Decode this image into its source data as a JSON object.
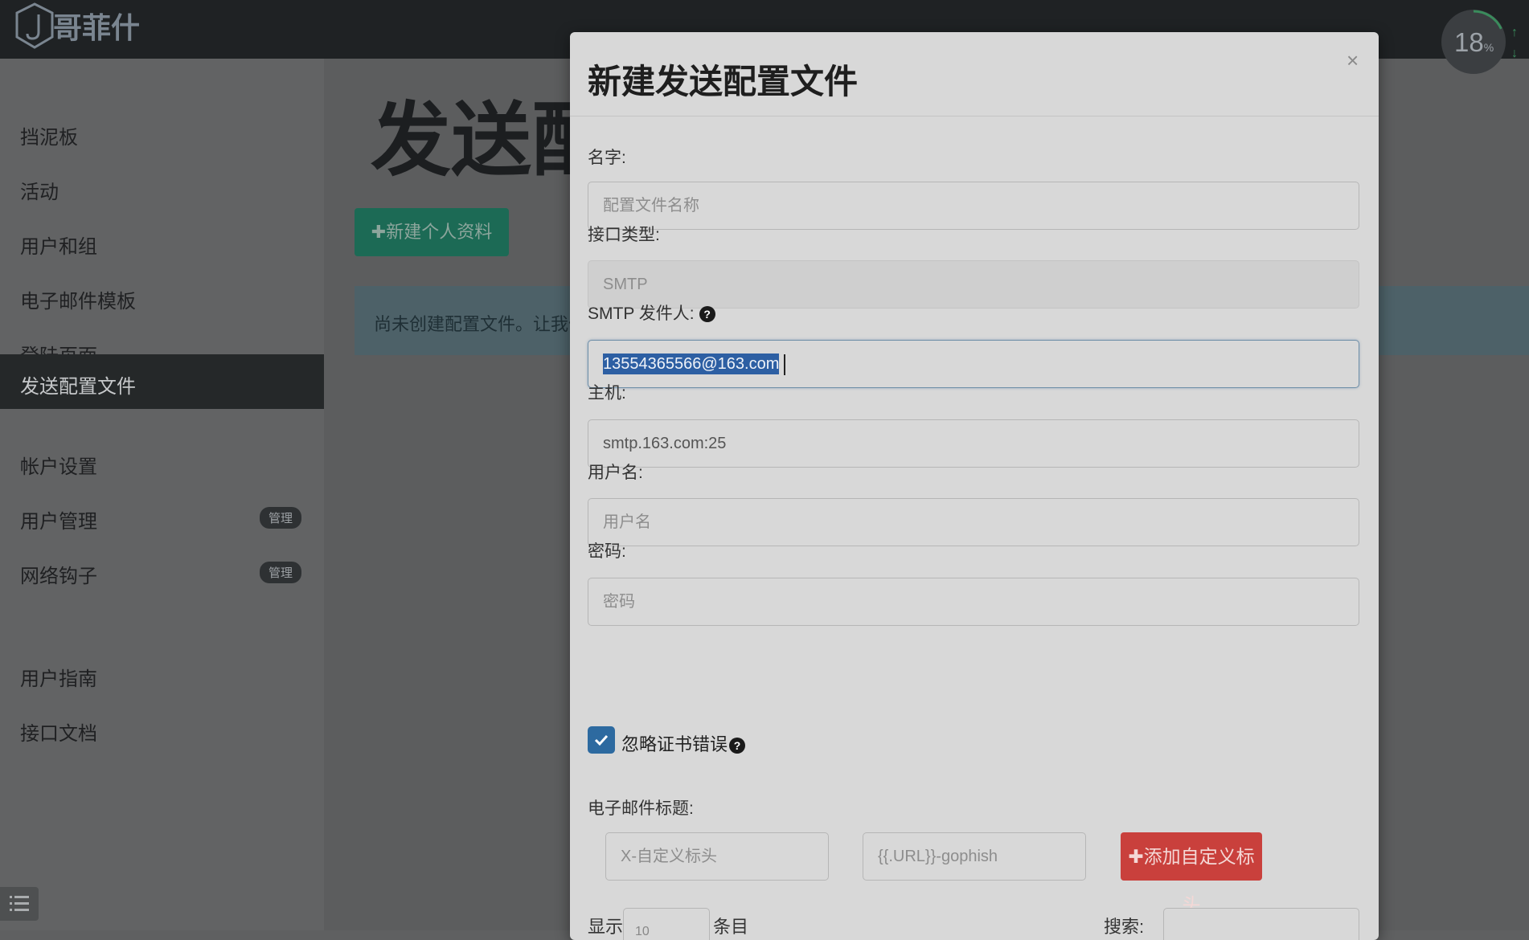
{
  "brand": {
    "name": "哥菲什"
  },
  "sidebar": {
    "items": [
      {
        "label": "挡泥板"
      },
      {
        "label": "活动"
      },
      {
        "label": "用户和组"
      },
      {
        "label": "电子邮件模板"
      },
      {
        "label": "登陆页面"
      },
      {
        "label": "发送配置文件",
        "active": true
      },
      {
        "label": "帐户设置"
      },
      {
        "label": "用户管理",
        "badge": "管理"
      },
      {
        "label": "网络钩子",
        "badge": "管理"
      },
      {
        "label": "用户指南"
      },
      {
        "label": "接口文档"
      }
    ]
  },
  "main": {
    "title": "发送配置文件",
    "new_button": "✚新建个人资料",
    "info_text": "尚未创建配置文件。让我们创建一个吧！"
  },
  "progress": {
    "value": "18",
    "unit": "%",
    "percent": 18
  },
  "modal": {
    "title": "新建发送配置文件",
    "close": "×",
    "name": {
      "label": "名字:",
      "placeholder": "配置文件名称"
    },
    "interface_type": {
      "label": "接口类型:",
      "value": "SMTP"
    },
    "smtp_from": {
      "label": "SMTP 发件人:",
      "help": "?",
      "value": "13554365566@163.com"
    },
    "host": {
      "label": "主机:",
      "value": "smtp.163.com:25"
    },
    "username": {
      "label": "用户名:",
      "placeholder": "用户名"
    },
    "password": {
      "label": "密码:",
      "placeholder": "密码"
    },
    "ignore_cert": {
      "label": "忽略证书错误",
      "help": "?",
      "checked": true
    },
    "email_headers": {
      "label": "电子邮件标题:",
      "header_placeholder": "X-自定义标头",
      "value_placeholder": "{{.URL}}-gophish",
      "add_button": "✚添加自定义标头"
    },
    "table_controls": {
      "show": "显示",
      "entries_value": "10",
      "entries": "条目",
      "search": "搜索:"
    }
  },
  "colors": {
    "primary": "#2d6aa0",
    "success": "#1c6a55",
    "danger": "#c9403c",
    "dark": "#1f2224"
  }
}
